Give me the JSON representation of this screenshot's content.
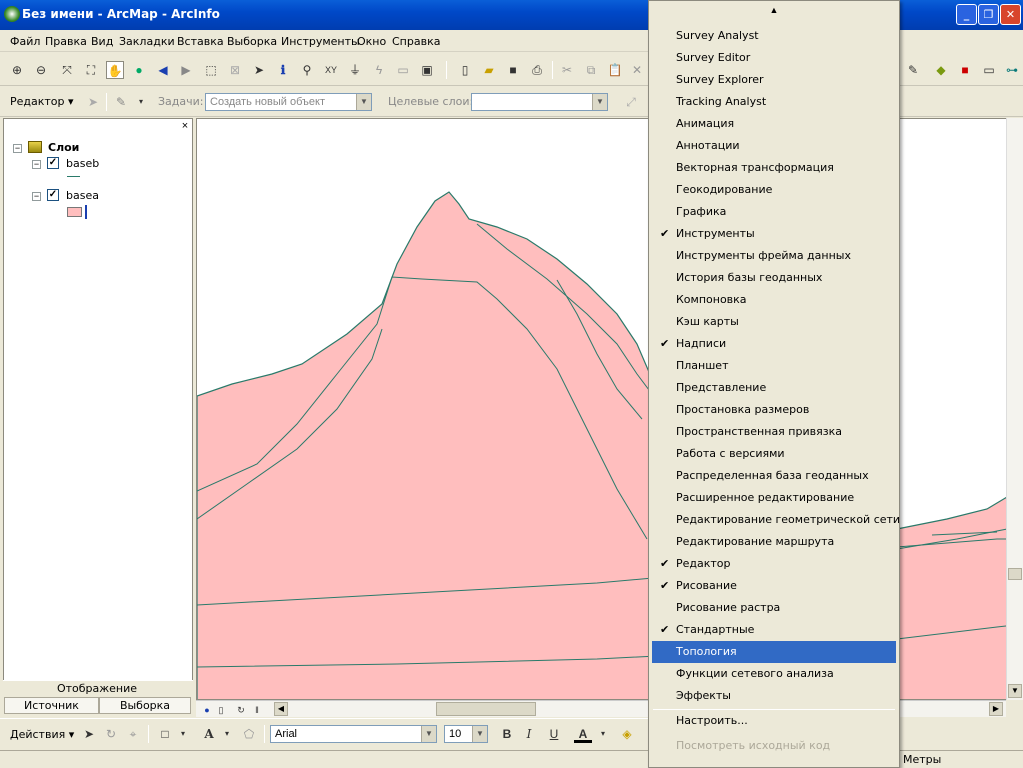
{
  "window": {
    "title": "Без имени - ArcMap - ArcInfo"
  },
  "menubar": {
    "items": [
      "Файл",
      "Правка",
      "Вид",
      "Закладки",
      "Вставка",
      "Выборка",
      "Инструменты",
      "Окно",
      "Справка"
    ]
  },
  "editor_toolbar": {
    "editor_label": "Редактор",
    "task_label": "Задачи:",
    "task_value": "Создать новый объект",
    "target_label": "Целевые слои:",
    "target_value": ""
  },
  "toc": {
    "root": "Слои",
    "layers": [
      {
        "name": "baseb",
        "visible": true
      },
      {
        "name": "basea",
        "visible": true
      }
    ],
    "display_label": "Отображение",
    "tabs": [
      "Источник",
      "Выборка"
    ]
  },
  "draw_toolbar": {
    "actions_label": "Действия",
    "font": "Arial",
    "size": "10"
  },
  "status": {
    "units": "Метры"
  },
  "menu": {
    "items": [
      {
        "label": "Survey Analyst",
        "checked": false
      },
      {
        "label": "Survey Editor",
        "checked": false
      },
      {
        "label": "Survey Explorer",
        "checked": false
      },
      {
        "label": "Tracking Analyst",
        "checked": false
      },
      {
        "label": "Анимация",
        "checked": false
      },
      {
        "label": "Аннотации",
        "checked": false
      },
      {
        "label": "Векторная трансформация",
        "checked": false
      },
      {
        "label": "Геокодирование",
        "checked": false
      },
      {
        "label": "Графика",
        "checked": false
      },
      {
        "label": "Инструменты",
        "checked": true
      },
      {
        "label": "Инструменты фрейма данных",
        "checked": false
      },
      {
        "label": "История базы геоданных",
        "checked": false
      },
      {
        "label": "Компоновка",
        "checked": false
      },
      {
        "label": "Кэш карты",
        "checked": false
      },
      {
        "label": "Надписи",
        "checked": true
      },
      {
        "label": "Планшет",
        "checked": false
      },
      {
        "label": "Представление",
        "checked": false
      },
      {
        "label": "Простановка размеров",
        "checked": false
      },
      {
        "label": "Пространственная привязка",
        "checked": false
      },
      {
        "label": "Работа с версиями",
        "checked": false
      },
      {
        "label": "Распределенная база геоданных",
        "checked": false
      },
      {
        "label": "Расширенное редактирование",
        "checked": false
      },
      {
        "label": "Редактирование геометрической сети",
        "checked": false
      },
      {
        "label": "Редактирование маршрута",
        "checked": false
      },
      {
        "label": "Редактор",
        "checked": true
      },
      {
        "label": "Рисование",
        "checked": true
      },
      {
        "label": "Рисование растра",
        "checked": false
      },
      {
        "label": "Стандартные",
        "checked": true
      },
      {
        "label": "Топология",
        "checked": false,
        "selected": true
      },
      {
        "label": "Функции сетевого анализа",
        "checked": false
      },
      {
        "label": "Эффекты",
        "checked": false
      }
    ],
    "customize_label": "Настроить...",
    "view_source_label": "Посмотреть исходный код"
  },
  "colors": {
    "title_bar": "#0054e3",
    "menu_highlight": "#316ac5",
    "polygon_fill": "#ffbebe",
    "polygon_outline": "#2a7a6a"
  }
}
